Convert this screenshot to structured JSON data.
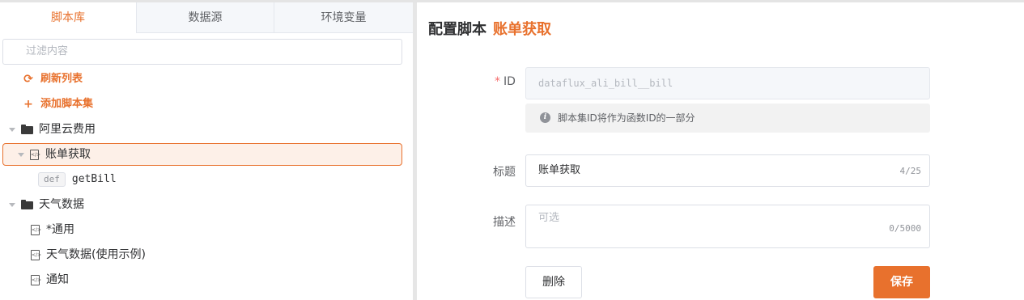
{
  "tabs": [
    {
      "label": "脚本库",
      "active": true
    },
    {
      "label": "数据源",
      "active": false
    },
    {
      "label": "环境变量",
      "active": false
    }
  ],
  "filter": {
    "placeholder": "过滤内容"
  },
  "actions": {
    "refresh": {
      "icon": "refresh-icon",
      "label": "刷新列表"
    },
    "add": {
      "icon": "plus-icon",
      "label": "添加脚本集"
    }
  },
  "tree": {
    "folder1": {
      "label": "阿里云费用",
      "expanded": true
    },
    "script_selected": {
      "label": "账单获取"
    },
    "func": {
      "badge": "def",
      "label": "getBill"
    },
    "folder2": {
      "label": "天气数据",
      "expanded": true
    },
    "script2": {
      "label": "*通用"
    },
    "script3": {
      "label": "天气数据(使用示例)"
    },
    "script4": {
      "label": "通知"
    }
  },
  "form": {
    "title_prefix": "配置脚本",
    "title_name": "账单获取",
    "id": {
      "required_mark": "*",
      "label": "ID",
      "value": "dataflux_ali_bill__bill"
    },
    "hint": "脚本集ID将作为函数ID的一部分",
    "title_field": {
      "label": "标题",
      "value": "账单获取",
      "count": "4/25"
    },
    "desc_field": {
      "label": "描述",
      "placeholder": "可选",
      "count": "0/5000"
    },
    "delete_label": "删除",
    "save_label": "保存"
  },
  "colors": {
    "accent": "#e8712d",
    "required": "#f56c6c"
  }
}
